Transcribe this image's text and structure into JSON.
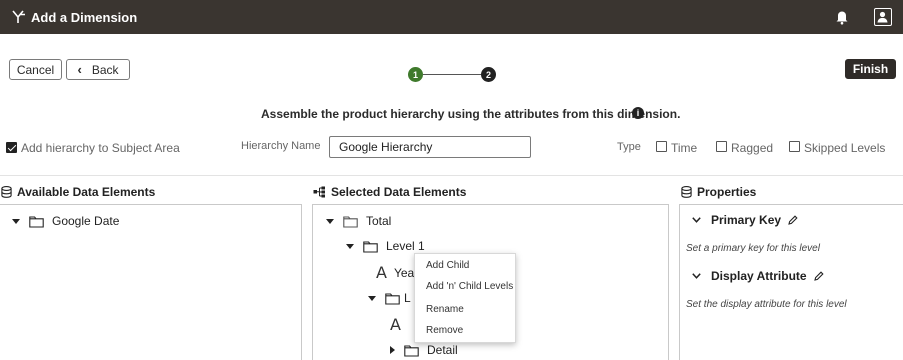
{
  "topbar": {
    "title": "Add a Dimension"
  },
  "actions": {
    "cancel_label": "Cancel",
    "back_label": "Back",
    "finish_label": "Finish"
  },
  "stepper": {
    "steps": [
      "1",
      "2"
    ],
    "current_step": 1
  },
  "instruction": "Assemble the product hierarchy using the attributes from this dimension.",
  "hierarchy_options": {
    "add_to_subject_area": {
      "label": "Add hierarchy to Subject Area",
      "checked": true
    },
    "hierarchy_name_label": "Hierarchy Name",
    "hierarchy_name_value": "Google Hierarchy",
    "type_label": "Type",
    "type_options": [
      {
        "label": "Time",
        "checked": false
      },
      {
        "label": "Ragged",
        "checked": false
      },
      {
        "label": "Skipped Levels",
        "checked": false
      }
    ]
  },
  "available": {
    "title": "Available Data Elements",
    "items": [
      "Google Date"
    ]
  },
  "selected": {
    "title": "Selected Data Elements",
    "total": "Total",
    "level1": "Level 1",
    "attr1": "Year",
    "level2": "L",
    "detail": "Detail"
  },
  "properties": {
    "title": "Properties",
    "primary_key": {
      "label": "Primary Key",
      "desc": "Set a primary key for this level"
    },
    "display_attribute": {
      "label": "Display Attribute",
      "desc": "Set the display attribute for this level"
    }
  },
  "context_menu": {
    "items": [
      "Add Child",
      "Add 'n' Child Levels",
      "Rename",
      "Remove"
    ]
  },
  "colors": {
    "topbar": "#3a3530",
    "step_done": "#3f7a2c",
    "step_current": "#222222",
    "finish_button": "#2f2b28"
  }
}
